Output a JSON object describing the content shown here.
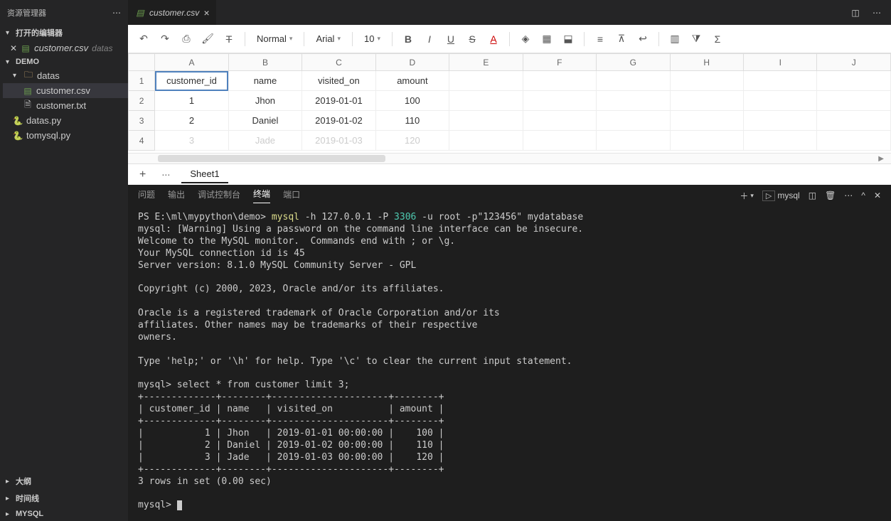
{
  "sidebar": {
    "title": "资源管理器",
    "openEditors": "打开的编辑器",
    "demoLabel": "DEMO",
    "datasLabel": "datas",
    "files": {
      "customerCsv": "customer.csv",
      "customerTxt": "customer.txt",
      "datasPy": "datas.py",
      "tomysqlPy": "tomysql.py"
    },
    "meta": "datas",
    "bottom": {
      "outline": "大纲",
      "timeline": "时间线",
      "mysql": "MYSQL"
    }
  },
  "tab": {
    "name": "customer.csv"
  },
  "toolbar": {
    "style": "Normal",
    "font": "Arial",
    "size": "10"
  },
  "cols": [
    "A",
    "B",
    "C",
    "D",
    "E",
    "F",
    "G",
    "H",
    "I",
    "J"
  ],
  "rows": [
    "1",
    "2",
    "3",
    "4"
  ],
  "cells": {
    "A1": "customer_id",
    "B1": "name",
    "C1": "visited_on",
    "D1": "amount",
    "A2": "1",
    "B2": "Jhon",
    "C2": "2019-01-01",
    "D2": "100",
    "A3": "2",
    "B3": "Daniel",
    "C3": "2019-01-02",
    "D3": "110",
    "A4": "3",
    "B4": "Jade",
    "C4": "2019-01-03",
    "D4": "120"
  },
  "sheetTab": "Sheet1",
  "panel": {
    "problems": "问题",
    "output": "输出",
    "debug": "调试控制台",
    "terminal": "终端",
    "ports": "端口",
    "launch": "mysql"
  },
  "term": {
    "prompt": "PS E:\\ml\\mypython\\demo> ",
    "cmd1": "mysql",
    "args1a": " -h 127.0.0.1 -P ",
    "port": "3306",
    "args1b": " -u root -p\"123456\" mydatabase",
    "l2": "mysql: [Warning] Using a password on the command line interface can be insecure.",
    "l3": "Welcome to the MySQL monitor.  Commands end with ; or \\g.",
    "l4": "Your MySQL connection id is 45",
    "l5": "Server version: 8.1.0 MySQL Community Server - GPL",
    "l6": "Copyright (c) 2000, 2023, Oracle and/or its affiliates.",
    "l7": "Oracle is a registered trademark of Oracle Corporation and/or its",
    "l8": "affiliates. Other names may be trademarks of their respective",
    "l9": "owners.",
    "l10": "Type 'help;' or '\\h' for help. Type '\\c' to clear the current input statement.",
    "p2": "mysql> ",
    "q2": "select * from customer limit 3;",
    "sep": "+-------------+--------+---------------------+--------+",
    "hdr": "| customer_id | name   | visited_on          | amount |",
    "r1": "|           1 | Jhon   | 2019-01-01 00:00:00 |    100 |",
    "r2": "|           2 | Daniel | 2019-01-02 00:00:00 |    110 |",
    "r3": "|           3 | Jade   | 2019-01-03 00:00:00 |    120 |",
    "res": "3 rows in set (0.00 sec)",
    "p3": "mysql> "
  }
}
